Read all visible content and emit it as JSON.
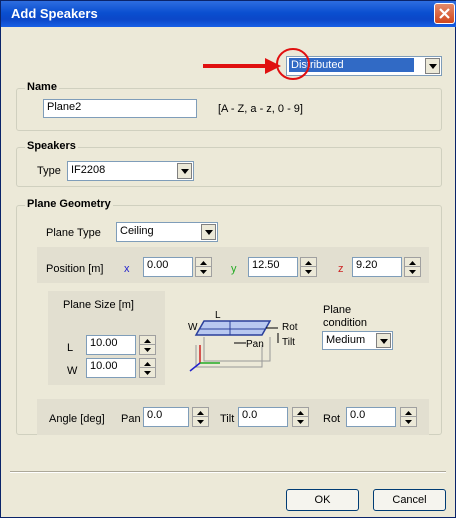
{
  "window": {
    "title": "Add Speakers"
  },
  "distribution": {
    "selected": "Distributed"
  },
  "name_group": {
    "label": "Name",
    "value": "Plane2",
    "hint": "[A - Z, a - z, 0 - 9]"
  },
  "speakers_group": {
    "label": "Speakers",
    "type_label": "Type",
    "type_value": "IF2208"
  },
  "plane_group": {
    "label": "Plane Geometry",
    "plane_type_label": "Plane Type",
    "plane_type_value": "Ceiling",
    "position": {
      "label": "Position [m]",
      "x_label": "x",
      "x_value": "0.00",
      "y_label": "y",
      "y_value": "12.50",
      "z_label": "z",
      "z_value": "9.20"
    },
    "size": {
      "label": "Plane Size [m]",
      "l_label": "L",
      "l_value": "10.00",
      "w_label": "W",
      "w_value": "10.00"
    },
    "diagram": {
      "l": "L",
      "w": "W",
      "rot": "Rot",
      "pan": "Pan",
      "tilt": "Tilt"
    },
    "condition": {
      "label_line1": "Plane",
      "label_line2": "condition",
      "value": "Medium"
    },
    "angle": {
      "label": "Angle [deg]",
      "pan_label": "Pan",
      "pan_value": "0.0",
      "tilt_label": "Tilt",
      "tilt_value": "0.0",
      "rot_label": "Rot",
      "rot_value": "0.0"
    }
  },
  "buttons": {
    "ok": "OK",
    "cancel": "Cancel"
  },
  "colors": {
    "x_axis": "#2222cc",
    "y_axis": "#22aa22",
    "z_axis": "#cc2222",
    "annotation": "#e01010"
  },
  "icons": [
    "close-icon",
    "chevron-down-icon",
    "spin-up-icon",
    "spin-down-icon",
    "red-arrow-icon",
    "red-circle-icon",
    "plane-diagram-icon"
  ]
}
